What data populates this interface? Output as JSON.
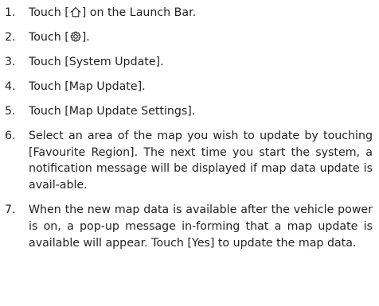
{
  "steps": [
    {
      "number": "1.",
      "prefix": "Touch [",
      "icon": "home-icon",
      "suffix": "] on the Launch Bar."
    },
    {
      "number": "2.",
      "prefix": "Touch [",
      "icon": "gear-icon",
      "suffix": "]."
    },
    {
      "number": "3.",
      "text": "Touch [System Update]."
    },
    {
      "number": "4.",
      "text": "Touch [Map Update]."
    },
    {
      "number": "5.",
      "text": "Touch [Map Update Settings]."
    },
    {
      "number": "6.",
      "text": "Select an area of the map you wish to update by touching [Favourite Region]. The next time you start the system, a notification message will be displayed if map data update is avail-able."
    },
    {
      "number": "7.",
      "text": "When the new map data is available after the vehicle power is on, a pop-up message in-forming that a map update is available will appear. Touch [Yes] to update the map data."
    }
  ]
}
